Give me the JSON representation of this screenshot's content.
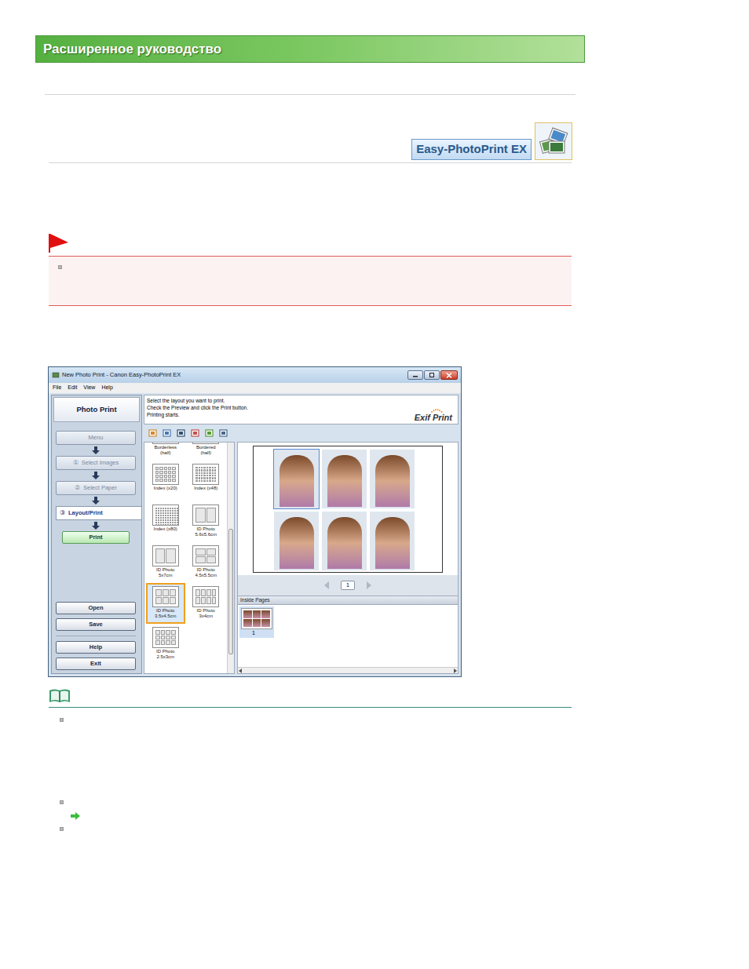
{
  "header": {
    "title": "Расширенное руководство"
  },
  "logo": {
    "text": "Easy-PhotoPrint EX"
  },
  "important": {
    "items": [
      {
        "kind": "bullet"
      }
    ]
  },
  "app": {
    "window": {
      "title": "New Photo Print - Canon Easy-PhotoPrint EX"
    },
    "menu": [
      "File",
      "Edit",
      "View",
      "Help"
    ],
    "sidebar": {
      "title": "Photo Print",
      "steps": [
        {
          "number": "",
          "label": "Menu",
          "selected": false
        },
        {
          "number": "①",
          "label": "Select Images",
          "selected": false
        },
        {
          "number": "②",
          "label": "Select Paper",
          "selected": false
        },
        {
          "number": "③",
          "label": "Layout/Print",
          "selected": true
        }
      ],
      "print": "Print",
      "file_buttons": [
        "Open",
        "Save"
      ],
      "app_buttons": [
        "Help",
        "Exit"
      ]
    },
    "instructions": [
      "Select the layout you want to print.",
      "Check the Preview and click the Print button.",
      "Printing starts."
    ],
    "exif": "Exif Print",
    "layouts": [
      {
        "lines": [
          "Borderless",
          "(half)"
        ],
        "kind": "half",
        "selected": false
      },
      {
        "lines": [
          "Bordered",
          "(half)"
        ],
        "kind": "half",
        "selected": false
      },
      {
        "lines": [
          "Index (x20)"
        ],
        "kind": "index20",
        "selected": false
      },
      {
        "lines": [
          "Index (x48)"
        ],
        "kind": "index48",
        "selected": false
      },
      {
        "lines": [
          "Index (x80)"
        ],
        "kind": "index80",
        "selected": false
      },
      {
        "lines": [
          "ID Photo",
          "5.6x5.6cm"
        ],
        "kind": "id56",
        "selected": false
      },
      {
        "lines": [
          "ID Photo",
          "5x7cm"
        ],
        "kind": "id57",
        "selected": false
      },
      {
        "lines": [
          "ID Photo",
          "4.5x5.5cm"
        ],
        "kind": "id4555",
        "selected": false
      },
      {
        "lines": [
          "ID Photo",
          "3.5x4.5cm"
        ],
        "kind": "id3545",
        "selected": true
      },
      {
        "lines": [
          "ID Photo",
          "3x4cm"
        ],
        "kind": "id34",
        "selected": false
      },
      {
        "lines": [
          "ID Photo",
          "2.5x3cm"
        ],
        "kind": "id2530",
        "selected": false
      }
    ],
    "preview": {
      "photos": [
        {
          "selected": true
        },
        {
          "selected": false
        },
        {
          "selected": false
        },
        {
          "selected": false
        },
        {
          "selected": false
        },
        {
          "selected": false
        }
      ],
      "page": "1"
    },
    "inside_pages": {
      "label": "Inside Pages",
      "pages": [
        {
          "number": "1",
          "selected": true
        }
      ]
    }
  },
  "note": {
    "items": [
      {
        "kind": "bullet"
      },
      {
        "kind": "bullet"
      },
      {
        "kind": "link"
      },
      {
        "kind": "bullet"
      }
    ]
  }
}
